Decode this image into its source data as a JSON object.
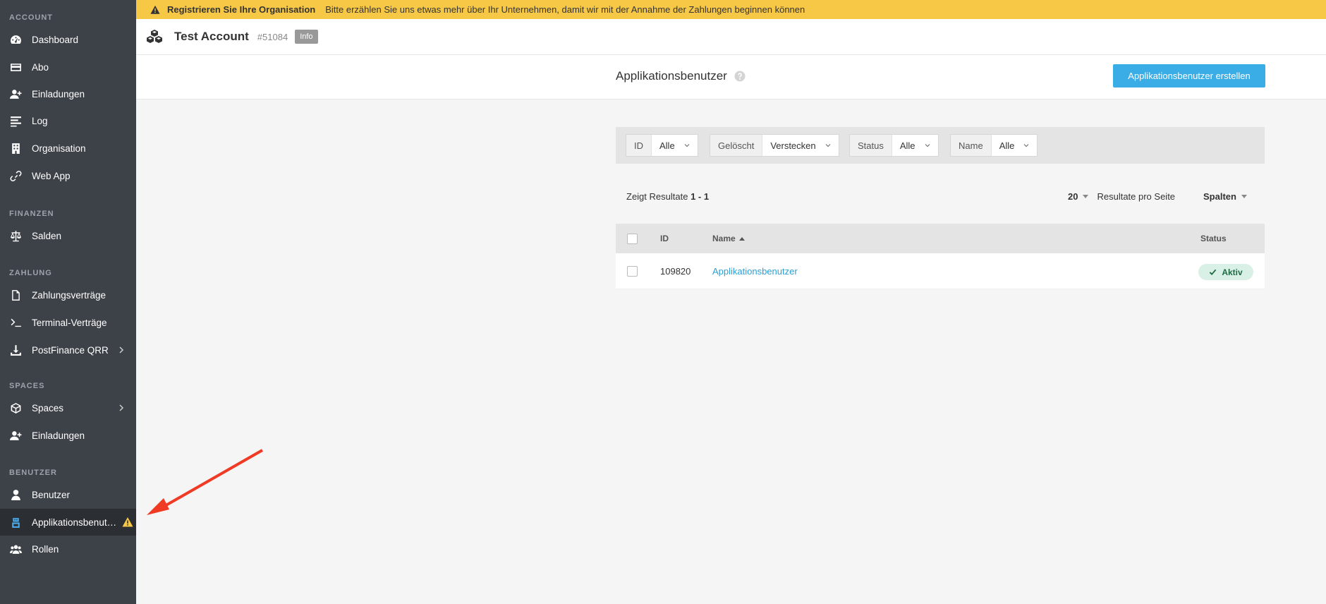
{
  "sidebar": {
    "sections": [
      {
        "title": "ACCOUNT"
      },
      {
        "title": "FINANZEN"
      },
      {
        "title": "ZAHLUNG"
      },
      {
        "title": "SPACES"
      },
      {
        "title": "BENUTZER"
      }
    ],
    "items": [
      {
        "label": "Dashboard",
        "icon": "dashboard-icon"
      },
      {
        "label": "Abo",
        "icon": "credit-card-icon"
      },
      {
        "label": "Einladungen",
        "icon": "user-plus-icon"
      },
      {
        "label": "Log",
        "icon": "list-icon"
      },
      {
        "label": "Organisation",
        "icon": "building-icon"
      },
      {
        "label": "Web App",
        "icon": "link-icon"
      },
      {
        "label": "Salden",
        "icon": "balance-scale-icon"
      },
      {
        "label": "Zahlungsverträge",
        "icon": "file-icon"
      },
      {
        "label": "Terminal-Verträge",
        "icon": "terminal-icon"
      },
      {
        "label": "PostFinance QRR",
        "icon": "download-icon"
      },
      {
        "label": "Spaces",
        "icon": "cube-icon"
      },
      {
        "label": "Einladungen",
        "icon": "user-plus-icon"
      },
      {
        "label": "Benutzer",
        "icon": "user-icon"
      },
      {
        "label": "Applikationsbenut…",
        "icon": "robot-user-icon"
      },
      {
        "label": "Rollen",
        "icon": "users-icon"
      }
    ]
  },
  "banner": {
    "title": "Registrieren Sie Ihre Organisation",
    "message": "Bitte erzählen Sie uns etwas mehr über Ihr Unternehmen, damit wir mit der Annahme der Zahlungen beginnen können",
    "color": "#f7c846"
  },
  "account": {
    "name": "Test Account",
    "id": "#51084",
    "badge": "Info"
  },
  "page": {
    "title": "Applikationsbenutzer",
    "create_button": "Applikationsbenutzer erstellen",
    "accent": "#3aade6"
  },
  "filters": [
    {
      "label": "ID",
      "value": "Alle"
    },
    {
      "label": "Gelöscht",
      "value": "Verstecken"
    },
    {
      "label": "Status",
      "value": "Alle"
    },
    {
      "label": "Name",
      "value": "Alle"
    }
  ],
  "results": {
    "prefix": "Zeigt Resultate",
    "range": "1 - 1",
    "per_page_value": "20",
    "per_page_label": "Resultate pro Seite",
    "columns_label": "Spalten"
  },
  "table": {
    "headers": {
      "id": "ID",
      "name": "Name",
      "status": "Status"
    },
    "rows": [
      {
        "id": "109820",
        "name": "Applikationsbenutzer",
        "status": "Aktiv"
      }
    ]
  }
}
